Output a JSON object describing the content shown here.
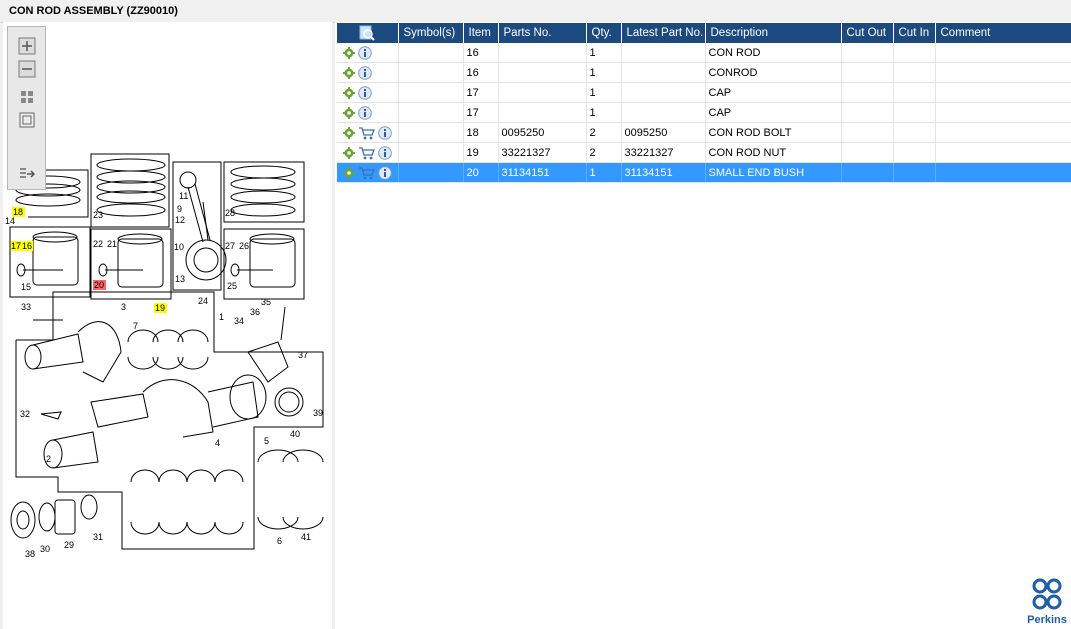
{
  "window": {
    "title": "CON ROD ASSEMBLY (ZZ90010)"
  },
  "zoom_toolbar": {
    "buttons": [
      "zoom-in-icon",
      "zoom-out-icon",
      "fit-all-icon",
      "actual-size-icon",
      "export-icon"
    ]
  },
  "diagram": {
    "labels": [
      "18",
      "14",
      "17",
      "16",
      "15",
      "23",
      "22",
      "21",
      "20",
      "19",
      "11",
      "9",
      "12",
      "10",
      "13",
      "24",
      "28",
      "27",
      "26",
      "25",
      "33",
      "3",
      "7",
      "1",
      "35",
      "36",
      "34",
      "37",
      "39",
      "32",
      "2",
      "5",
      "4",
      "40",
      "38",
      "30",
      "29",
      "31",
      "6",
      "41"
    ],
    "highlight_yellow": [
      "18",
      "17",
      "16",
      "19"
    ],
    "highlight_red": [
      "20"
    ]
  },
  "table": {
    "columns": [
      "",
      "Symbol(s)",
      "Item",
      "Parts No.",
      "Qty.",
      "Latest Part No.",
      "Description",
      "Cut Out",
      "Cut In",
      "Comment"
    ],
    "rows": [
      {
        "icons": [
          "gear",
          "info"
        ],
        "item": "16",
        "parts_no": "",
        "qty": "1",
        "latest": "",
        "desc": "CON ROD",
        "cut_out": "",
        "cut_in": "",
        "comment": ""
      },
      {
        "icons": [
          "gear",
          "info"
        ],
        "item": "16",
        "parts_no": "",
        "qty": "1",
        "latest": "",
        "desc": "CONROD",
        "cut_out": "",
        "cut_in": "",
        "comment": ""
      },
      {
        "icons": [
          "gear",
          "info"
        ],
        "item": "17",
        "parts_no": "",
        "qty": "1",
        "latest": "",
        "desc": "CAP",
        "cut_out": "",
        "cut_in": "",
        "comment": ""
      },
      {
        "icons": [
          "gear",
          "info"
        ],
        "item": "17",
        "parts_no": "",
        "qty": "1",
        "latest": "",
        "desc": "CAP",
        "cut_out": "",
        "cut_in": "",
        "comment": ""
      },
      {
        "icons": [
          "gear",
          "cart",
          "info"
        ],
        "item": "18",
        "parts_no": "0095250",
        "qty": "2",
        "latest": "0095250",
        "desc": "CON ROD BOLT",
        "cut_out": "",
        "cut_in": "",
        "comment": ""
      },
      {
        "icons": [
          "gear",
          "cart",
          "info"
        ],
        "item": "19",
        "parts_no": "33221327",
        "qty": "2",
        "latest": "33221327",
        "desc": "CON ROD NUT",
        "cut_out": "",
        "cut_in": "",
        "comment": ""
      },
      {
        "icons": [
          "gear",
          "cart",
          "info"
        ],
        "item": "20",
        "parts_no": "31134151",
        "qty": "1",
        "latest": "31134151",
        "desc": "SMALL END BUSH",
        "cut_out": "",
        "cut_in": "",
        "comment": "",
        "selected": true
      }
    ]
  },
  "logo": {
    "text": "Perkins"
  },
  "colors": {
    "header_bg": "#1d4a7e",
    "selection": "#3399ff",
    "highlight_yellow": "#ffff00",
    "highlight_red": "#ff6666",
    "brand": "#1f5ea8"
  }
}
